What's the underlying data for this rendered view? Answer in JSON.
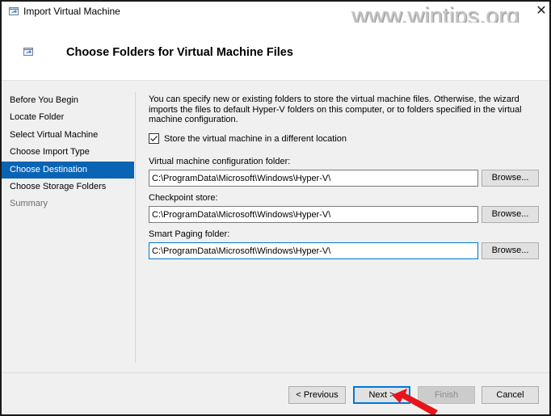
{
  "window": {
    "title": "Import Virtual Machine",
    "close_glyph": "✕",
    "watermark": "www.wintips.org"
  },
  "header": {
    "title": "Choose Folders for Virtual Machine Files"
  },
  "sidebar": {
    "items": [
      {
        "label": "Before You Begin",
        "state": "normal"
      },
      {
        "label": "Locate Folder",
        "state": "normal"
      },
      {
        "label": "Select Virtual Machine",
        "state": "normal"
      },
      {
        "label": "Choose Import Type",
        "state": "normal"
      },
      {
        "label": "Choose Destination",
        "state": "active"
      },
      {
        "label": "Choose Storage Folders",
        "state": "normal"
      },
      {
        "label": "Summary",
        "state": "disabled"
      }
    ]
  },
  "content": {
    "description": "You can specify new or existing folders to store the virtual machine files. Otherwise, the wizard imports the files to default Hyper-V folders on this computer, or to folders specified in the virtual machine configuration.",
    "store_checkbox": {
      "label": "Store the virtual machine in a different location",
      "checked": true
    },
    "fields": [
      {
        "label": "Virtual machine configuration folder:",
        "value": "C:\\ProgramData\\Microsoft\\Windows\\Hyper-V\\",
        "browse_label": "Browse..."
      },
      {
        "label": "Checkpoint store:",
        "value": "C:\\ProgramData\\Microsoft\\Windows\\Hyper-V\\",
        "browse_label": "Browse..."
      },
      {
        "label": "Smart Paging folder:",
        "value": "C:\\ProgramData\\Microsoft\\Windows\\Hyper-V\\",
        "browse_label": "Browse..."
      }
    ]
  },
  "footer": {
    "previous_label": "< Previous",
    "next_label": "Next >",
    "finish_label": "Finish",
    "cancel_label": "Cancel"
  },
  "colors": {
    "active_item": "#0a64b4",
    "focus_border": "#0078d7",
    "annotation_arrow": "#e8141c"
  }
}
